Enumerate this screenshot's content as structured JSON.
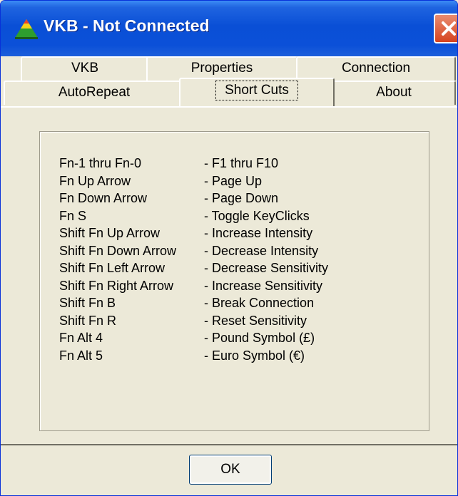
{
  "window": {
    "title": "VKB - Not Connected"
  },
  "tabs": {
    "back": [
      {
        "label": "VKB"
      },
      {
        "label": "Properties"
      },
      {
        "label": "Connection"
      }
    ],
    "front": [
      {
        "label": "AutoRepeat"
      },
      {
        "label": "Short Cuts"
      },
      {
        "label": "About"
      }
    ],
    "active": "Short Cuts"
  },
  "shortcuts": [
    {
      "keys": "Fn-1 thru Fn-0",
      "action": "- F1 thru F10"
    },
    {
      "keys": "Fn Up Arrow",
      "action": "- Page Up"
    },
    {
      "keys": "Fn Down Arrow",
      "action": "- Page Down"
    },
    {
      "keys": "Fn S",
      "action": "- Toggle KeyClicks"
    },
    {
      "keys": "Shift Fn Up Arrow",
      "action": "- Increase Intensity"
    },
    {
      "keys": "Shift Fn Down Arrow",
      "action": "- Decrease Intensity"
    },
    {
      "keys": "Shift Fn Left Arrow",
      "action": "- Decrease Sensitivity"
    },
    {
      "keys": "Shift Fn Right Arrow",
      "action": "- Increase Sensitivity"
    },
    {
      "keys": "Shift Fn B",
      "action": "- Break Connection"
    },
    {
      "keys": "Shift Fn R",
      "action": "- Reset Sensitivity"
    },
    {
      "keys": "Fn Alt 4",
      "action": "- Pound Symbol (£)"
    },
    {
      "keys": "Fn Alt 5",
      "action": "- Euro Symbol (€)"
    }
  ],
  "buttons": {
    "ok": "OK"
  },
  "icons": {
    "app": "pyramid-icon",
    "close": "close-icon"
  },
  "colors": {
    "titlebar": "#0A4FD6",
    "close": "#D6431F",
    "face": "#ECE9D8"
  }
}
